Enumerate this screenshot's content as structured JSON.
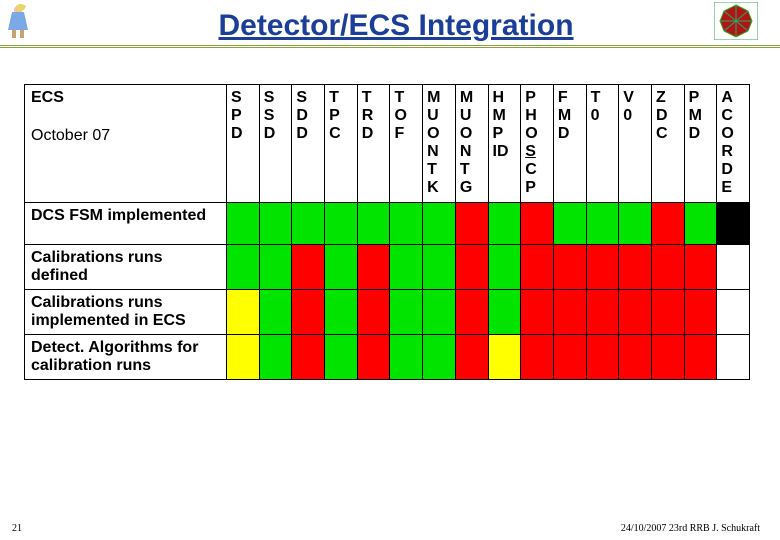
{
  "header": {
    "title": "Detector/ECS Integration",
    "left_logo_name": "alice-figure-icon",
    "right_logo_name": "red-octagon-icon"
  },
  "table": {
    "corner_label_top": "ECS",
    "corner_label_bottom": "October 07",
    "columns": [
      {
        "id": "spd",
        "lines": [
          "S",
          "P",
          "D"
        ],
        "sub": []
      },
      {
        "id": "ssd",
        "lines": [
          "S",
          "S",
          "D"
        ],
        "sub": []
      },
      {
        "id": "sdd",
        "lines": [
          "S",
          "D",
          "D"
        ],
        "sub": []
      },
      {
        "id": "tpc",
        "lines": [
          "T",
          "P",
          "C"
        ],
        "sub": []
      },
      {
        "id": "trd",
        "lines": [
          "T",
          "R",
          "D"
        ],
        "sub": []
      },
      {
        "id": "tof",
        "lines": [
          "T",
          "O",
          "F"
        ],
        "sub": []
      },
      {
        "id": "muontk",
        "lines": [
          "M",
          "U",
          "O",
          "N"
        ],
        "sub": [
          "T",
          "K"
        ]
      },
      {
        "id": "muontg",
        "lines": [
          "M",
          "U",
          "O",
          "N"
        ],
        "sub": [
          "T",
          "G"
        ]
      },
      {
        "id": "hmpid",
        "lines": [
          "H",
          "M",
          "P",
          "ID"
        ],
        "sub": []
      },
      {
        "id": "phoscp",
        "lines": [
          "P",
          "H",
          "O",
          "S"
        ],
        "sub": [
          "C",
          "P"
        ],
        "underline_last": true
      },
      {
        "id": "fmd",
        "lines": [
          "F",
          "M",
          "D"
        ],
        "sub": []
      },
      {
        "id": "t0",
        "lines": [
          "T",
          "0"
        ],
        "sub": []
      },
      {
        "id": "v0",
        "lines": [
          "V",
          "0"
        ],
        "sub": []
      },
      {
        "id": "zdc",
        "lines": [
          "Z",
          "D",
          "C"
        ],
        "sub": []
      },
      {
        "id": "pmd",
        "lines": [
          "P",
          "M",
          "D"
        ],
        "sub": []
      },
      {
        "id": "acorde",
        "lines": [
          "A",
          "C",
          "O",
          "R",
          "D",
          "E"
        ],
        "sub": []
      }
    ],
    "rows": [
      {
        "label": "DCS FSM implemented",
        "cells": [
          "g",
          "g",
          "g",
          "g",
          "g",
          "g",
          "g",
          "r",
          "g",
          "r",
          "g",
          "g",
          "g",
          "r",
          "g",
          "k"
        ]
      },
      {
        "label": "Calibrations runs defined",
        "cells": [
          "g",
          "g",
          "r",
          "g",
          "r",
          "g",
          "g",
          "r",
          "g",
          "r",
          "r",
          "r",
          "r",
          "r",
          "r",
          "w"
        ]
      },
      {
        "label": "Calibrations runs implemented in ECS",
        "cells": [
          "y",
          "g",
          "r",
          "g",
          "r",
          "g",
          "g",
          "r",
          "g",
          "r",
          "r",
          "r",
          "r",
          "r",
          "r",
          "w"
        ]
      },
      {
        "label": "Detect. Algorithms for calibration runs",
        "cells": [
          "y",
          "g",
          "r",
          "g",
          "r",
          "g",
          "g",
          "r",
          "y",
          "r",
          "r",
          "r",
          "r",
          "r",
          "r",
          "w"
        ]
      }
    ]
  },
  "footer": {
    "text": "24/10/2007 23rd RRB J. Schukraft",
    "slide": "21"
  },
  "colors": {
    "green": "#00e400",
    "red": "#ff0000",
    "yellow": "#ffff00"
  }
}
